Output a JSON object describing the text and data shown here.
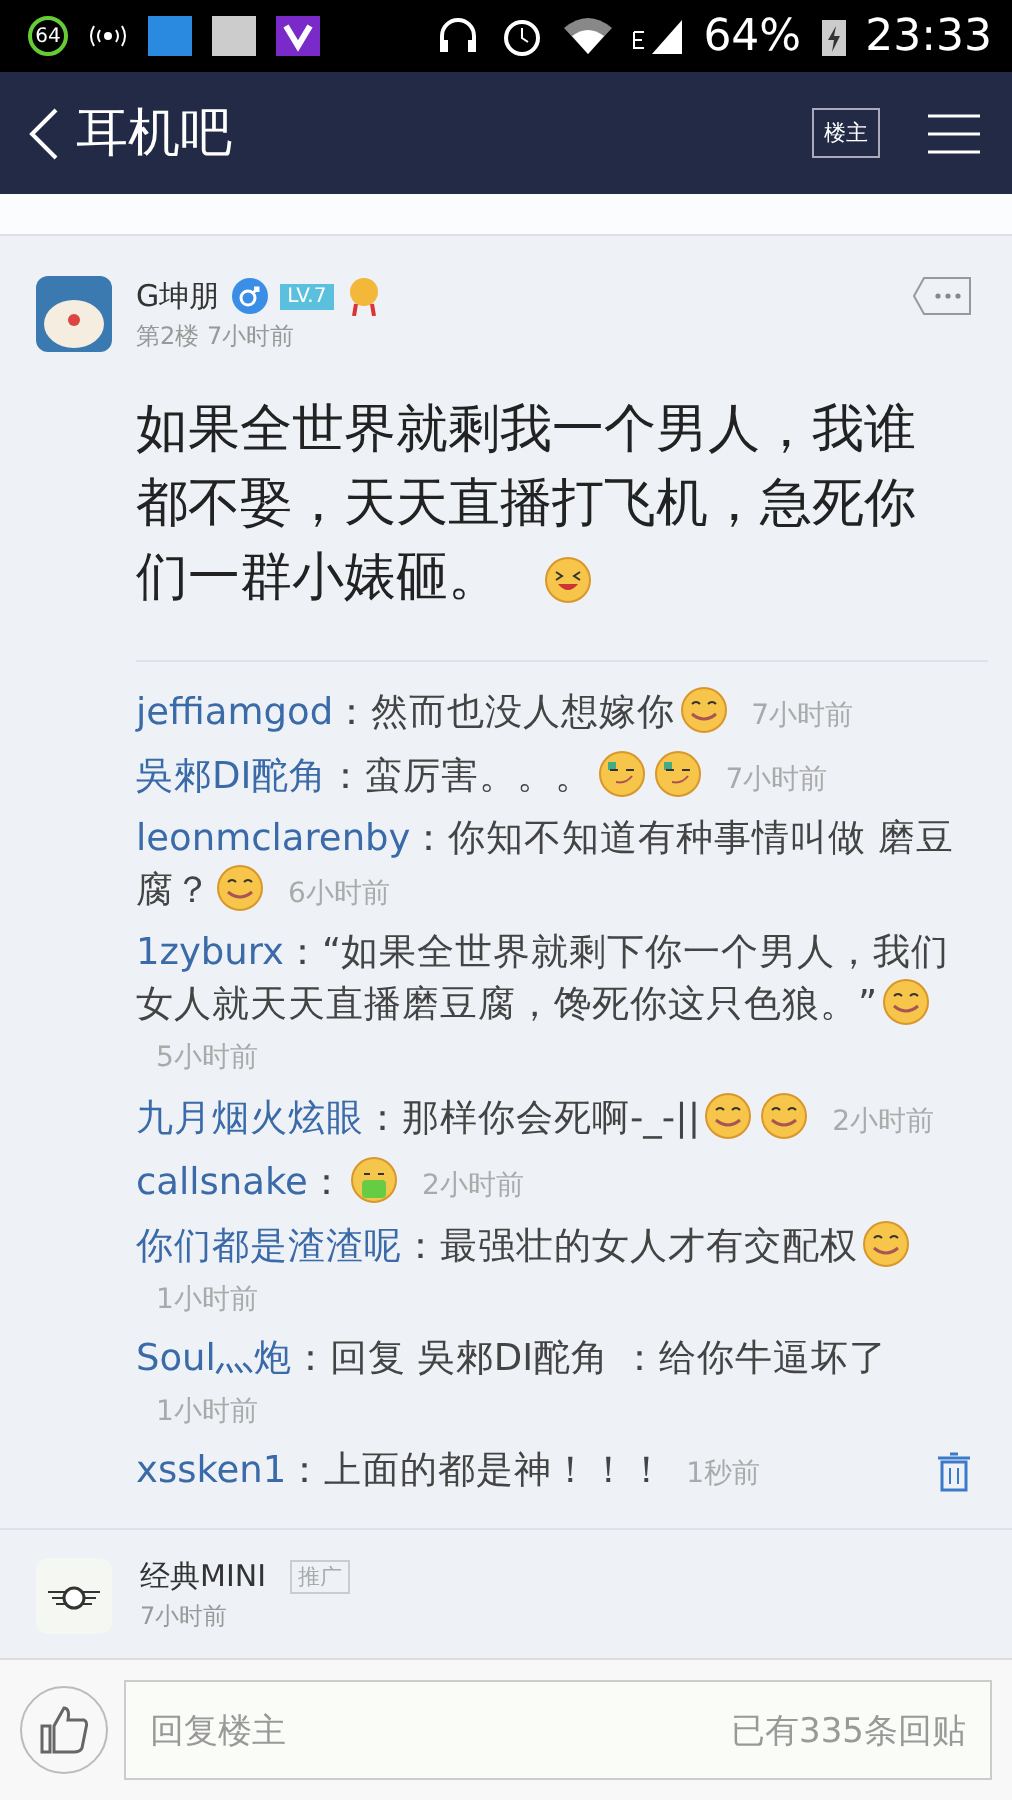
{
  "status_bar": {
    "badge": "64",
    "battery": "64%",
    "time": "23:33"
  },
  "header": {
    "title": "耳机吧",
    "owner_button": "楼主"
  },
  "post": {
    "author": "G坤朋",
    "level": "LV.7",
    "floor": "第2楼",
    "time": "7小时前",
    "body": "如果全世界就剩我一个男人，我谁都不娶，天天直播打飞机，急死你们一群小婊砸。",
    "emoticons": [
      {
        "kind": "laugh"
      }
    ]
  },
  "comments": [
    {
      "user": "jeffiamgod",
      "text": "：然而也没人想嫁你",
      "emoticons": [
        {
          "kind": "smile"
        }
      ],
      "time": "7小时前",
      "deletable": false
    },
    {
      "user": "吳郲DI酡角",
      "text": "：蛮厉害。。。",
      "emoticons": [
        {
          "kind": "smirk"
        },
        {
          "kind": "smirk"
        }
      ],
      "time": "7小时前",
      "deletable": false
    },
    {
      "user": "leonmclarenby",
      "text": "：你知不知道有种事情叫做 磨豆腐？",
      "emoticons": [
        {
          "kind": "smile"
        }
      ],
      "time": "6小时前",
      "deletable": false
    },
    {
      "user": "1zyburx",
      "text": "：“如果全世界就剩下你一个男人，我们女人就天天直播磨豆腐，馋死你这只色狼。”",
      "emoticons": [
        {
          "kind": "smile"
        }
      ],
      "time": "5小时前",
      "deletable": false
    },
    {
      "user": "九月烟火炫眼",
      "text": "：那样你会死啊-_-||",
      "emoticons": [
        {
          "kind": "smile"
        },
        {
          "kind": "smile"
        }
      ],
      "time": "2小时前",
      "deletable": false
    },
    {
      "user": "callsnake",
      "text": "：",
      "emoticons": [
        {
          "kind": "sick"
        }
      ],
      "time": "2小时前",
      "deletable": false
    },
    {
      "user": "你们都是渣渣呢",
      "text": "：最强壮的女人才有交配权",
      "emoticons": [
        {
          "kind": "smile"
        }
      ],
      "time": "1小时前",
      "deletable": false
    },
    {
      "user": "Soul灬炮",
      "text": "：回复 吳郲DI酡角 ：给你牛逼坏了",
      "time": "1小时前",
      "deletable": false
    },
    {
      "user": "xssken1",
      "text": "：上面的都是神！！！",
      "time": "1秒前",
      "deletable": true
    }
  ],
  "ad": {
    "name": "经典MINI",
    "tag": "推广",
    "time": "7小时前"
  },
  "reply_bar": {
    "placeholder": "回复楼主",
    "count": "已有335条回贴"
  }
}
